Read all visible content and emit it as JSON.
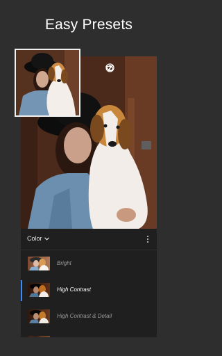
{
  "headline": "Easy Presets",
  "toolbar": {
    "undo_icon": "undo-icon",
    "help_icon": "help-icon",
    "done_icon": "checkmark-icon"
  },
  "presets_panel": {
    "category_label": "Color",
    "items": [
      {
        "label": "Bright",
        "selected": false
      },
      {
        "label": "High Contrast",
        "selected": true
      },
      {
        "label": "High Contrast & Detail",
        "selected": false
      }
    ]
  },
  "colors": {
    "accent": "#3b8bff",
    "panel_bg": "#1f1f1f",
    "page_bg": "#2e2e2e"
  }
}
